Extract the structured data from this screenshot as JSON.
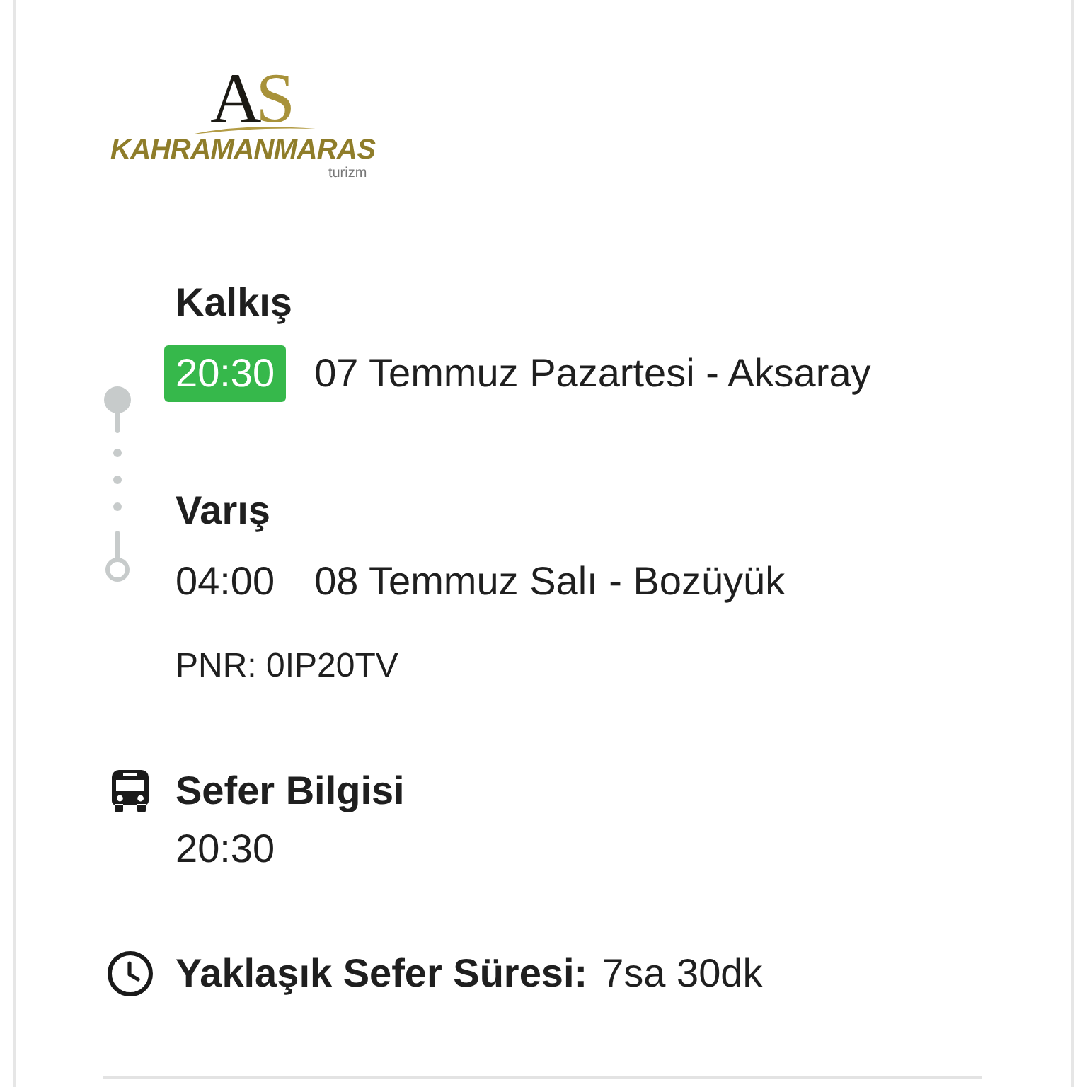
{
  "logo": {
    "monogram": "AS",
    "name": "KAHRAMANMARAS",
    "tagline": "turizm"
  },
  "stops": [
    {
      "kind": "departure",
      "label": "Kalkış",
      "time": "20:30",
      "highlighted": true,
      "details": "07 Temmuz Pazartesi - Aksaray"
    },
    {
      "kind": "arrival",
      "label": "Varış",
      "time": "04:00",
      "highlighted": false,
      "details": "08 Temmuz Salı - Bozüyük"
    }
  ],
  "pnr": "PNR: 0IP20TV",
  "trip_info": {
    "title": "Sefer Bilgisi",
    "value": "20:30"
  },
  "duration": {
    "label": "Yaklaşık Sefer Süresi:",
    "value": "7sa 30dk"
  }
}
